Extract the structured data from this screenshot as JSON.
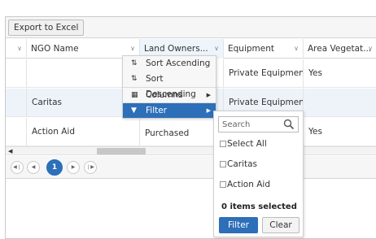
{
  "toolbar": {
    "export_label": "Export to Excel"
  },
  "grid": {
    "columns": [
      {
        "label": "NGO Name"
      },
      {
        "label": "Land Owners..."
      },
      {
        "label": "Equipment"
      },
      {
        "label": "Area Vegetat..."
      }
    ],
    "rows": [
      {
        "ngo": "",
        "land": "",
        "equipment": "Private Equipment",
        "area": "Yes"
      },
      {
        "ngo": "Caritas",
        "land": "",
        "equipment": "Private Equipment",
        "area": ""
      },
      {
        "ngo": "Action Aid",
        "land": "Purchased",
        "equipment": "",
        "area": "Yes"
      }
    ]
  },
  "pager": {
    "current_page": "1"
  },
  "column_menu": {
    "items": [
      {
        "label": "Sort Ascending",
        "icon": "sort-ascending-icon"
      },
      {
        "label": "Sort Descending",
        "icon": "sort-descending-icon"
      },
      {
        "label": "Columns",
        "icon": "columns-icon"
      },
      {
        "label": "Filter",
        "icon": "filter-icon"
      }
    ]
  },
  "filter": {
    "search_placeholder": "Search",
    "options": [
      "Select All",
      "Caritas",
      "Action Aid"
    ],
    "selected_count_text": "0 items selected",
    "filter_label": "Filter",
    "clear_label": "Clear"
  },
  "colors": {
    "accent": "#2d6fb8",
    "row_alt": "#eef3fa"
  }
}
